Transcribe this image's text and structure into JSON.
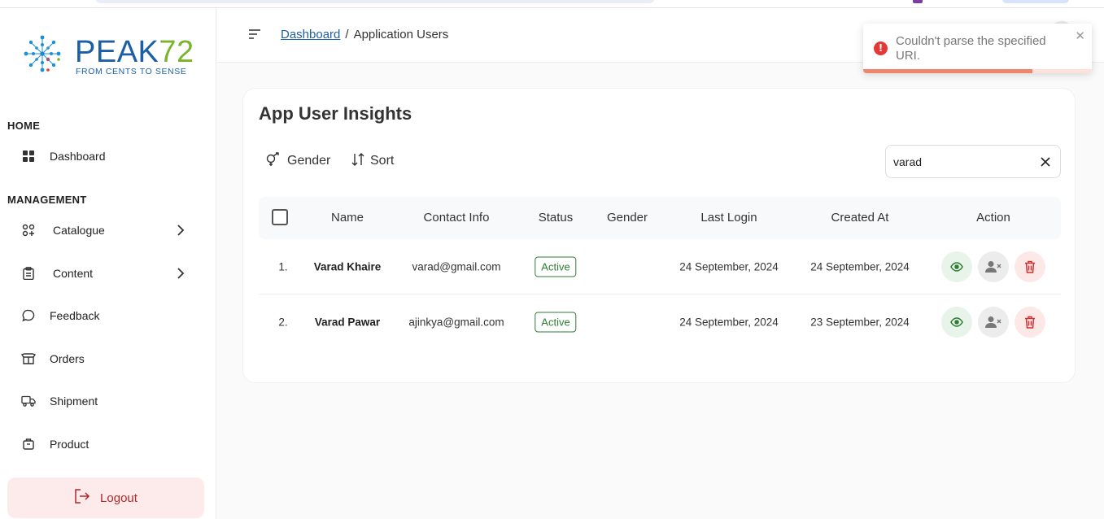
{
  "app": {
    "logo_name": "PEAK",
    "logo_number": "72",
    "logo_tagline": "FROM CENTS TO SENSE"
  },
  "sidebar": {
    "sections": [
      {
        "label": "HOME"
      },
      {
        "label": "MANAGEMENT"
      }
    ],
    "items": [
      {
        "label": "Dashboard",
        "icon": "grid-icon"
      },
      {
        "label": "Catalogue",
        "icon": "catalogue-icon",
        "has_submenu": true
      },
      {
        "label": "Content",
        "icon": "clipboard-icon",
        "has_submenu": true
      },
      {
        "label": "Feedback",
        "icon": "chat-bubble-icon"
      },
      {
        "label": "Orders",
        "icon": "open-box-icon"
      },
      {
        "label": "Shipment",
        "icon": "truck-icon"
      },
      {
        "label": "Product",
        "icon": "package-icon"
      }
    ],
    "logout_label": "Logout"
  },
  "header": {
    "breadcrumb_root": "Dashboard",
    "breadcrumb_sep": "/",
    "breadcrumb_current": "Application Users"
  },
  "toast": {
    "message": "Couldn't parse the specified URI.",
    "type": "error",
    "color": "#e53935",
    "progress": 0.74
  },
  "card": {
    "title": "App User Insights",
    "filters": {
      "gender_label": "Gender",
      "sort_label": "Sort"
    },
    "search": {
      "value": "varad"
    }
  },
  "table": {
    "columns": [
      "Name",
      "Contact Info",
      "Status",
      "Gender",
      "Last Login",
      "Created At",
      "Action"
    ],
    "rows": [
      {
        "index": "1.",
        "name": "Varad Khaire",
        "contact": "varad@gmail.com",
        "status": "Active",
        "gender": "",
        "last_login": "24 September, 2024",
        "created_at": "24 September, 2024"
      },
      {
        "index": "2.",
        "name": "Varad Pawar",
        "contact": "ajinkya@gmail.com",
        "status": "Active",
        "gender": "",
        "last_login": "24 September, 2024",
        "created_at": "23 September, 2024"
      }
    ]
  },
  "colors": {
    "brand_blue": "#1d5fa6",
    "brand_green": "#7ab32e",
    "status_active": "#2e7d32",
    "danger": "#d32f2f",
    "logout_bg": "#fdebeb"
  }
}
